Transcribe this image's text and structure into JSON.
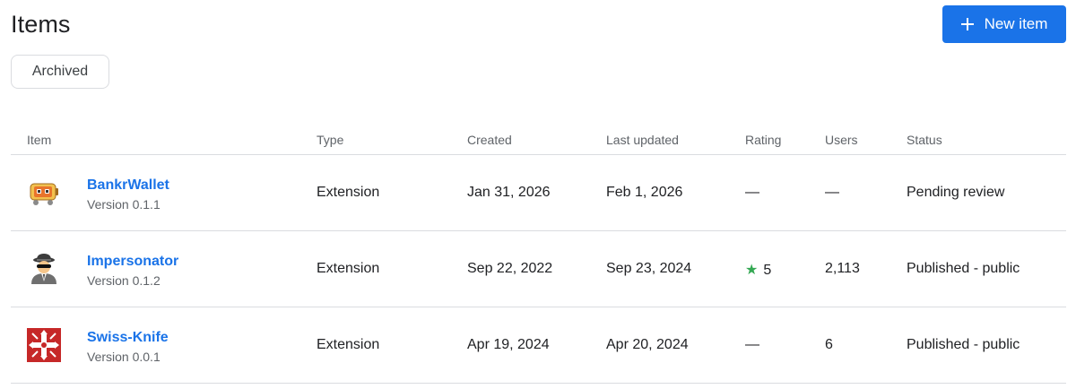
{
  "header": {
    "title": "Items",
    "new_item_label": "New item"
  },
  "filters": {
    "archived_label": "Archived"
  },
  "table": {
    "columns": {
      "item": "Item",
      "type": "Type",
      "created": "Created",
      "updated": "Last updated",
      "rating": "Rating",
      "users": "Users",
      "status": "Status"
    },
    "rows": [
      {
        "icon": "robot-wallet-icon",
        "name": "BankrWallet",
        "version": "Version 0.1.1",
        "type": "Extension",
        "created": "Jan 31, 2026",
        "updated": "Feb 1, 2026",
        "rating": "—",
        "users": "—",
        "status": "Pending review"
      },
      {
        "icon": "spy-icon",
        "name": "Impersonator",
        "version": "Version 0.1.2",
        "type": "Extension",
        "created": "Sep 22, 2022",
        "updated": "Sep 23, 2024",
        "rating": "5",
        "users": "2,113",
        "status": "Published - public"
      },
      {
        "icon": "swiss-knife-icon",
        "name": "Swiss-Knife",
        "version": "Version 0.0.1",
        "type": "Extension",
        "created": "Apr 19, 2024",
        "updated": "Apr 20, 2024",
        "rating": "—",
        "users": "6",
        "status": "Published - public"
      }
    ]
  },
  "colors": {
    "accent": "#1a73e8",
    "star": "#34a853",
    "divider": "#dadce0"
  }
}
